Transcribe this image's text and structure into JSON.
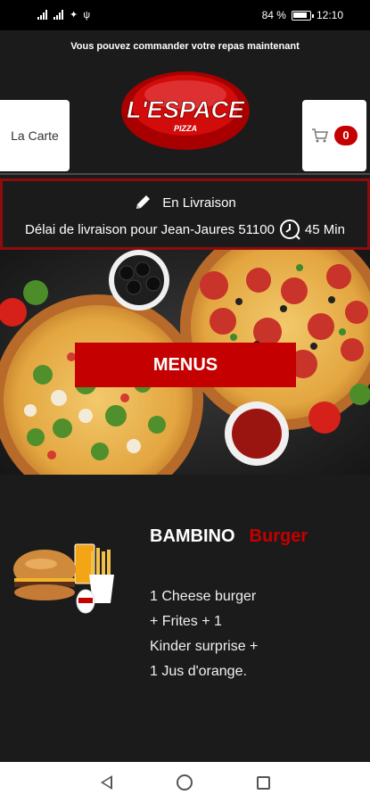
{
  "status_bar": {
    "battery": "84 %",
    "time": "12:10",
    "icons": [
      "signal-icon",
      "signal-icon",
      "wifi-icon",
      "usb-icon",
      "battery-icon"
    ]
  },
  "header": {
    "notice": "Vous pouvez commander votre repas maintenant",
    "menu_button_label": "La Carte",
    "cart_count": "0",
    "logo_text": "L'ESPACE",
    "logo_subtext": "PIZZA"
  },
  "delivery": {
    "mode_label": "En Livraison",
    "info_text": "Délai de livraison pour Jean-Jaures 51100",
    "duration": "45 Min"
  },
  "hero": {
    "button_label": "MENUS"
  },
  "product": {
    "name": "BAMBINO",
    "category": "Burger",
    "description_lines": [
      "1 Cheese burger",
      "+ Frites + 1",
      "Kinder surprise +",
      "1 Jus d'orange."
    ]
  },
  "colors": {
    "accent": "#c40000",
    "border": "#8e0c0c",
    "background": "#1b1b1b"
  }
}
